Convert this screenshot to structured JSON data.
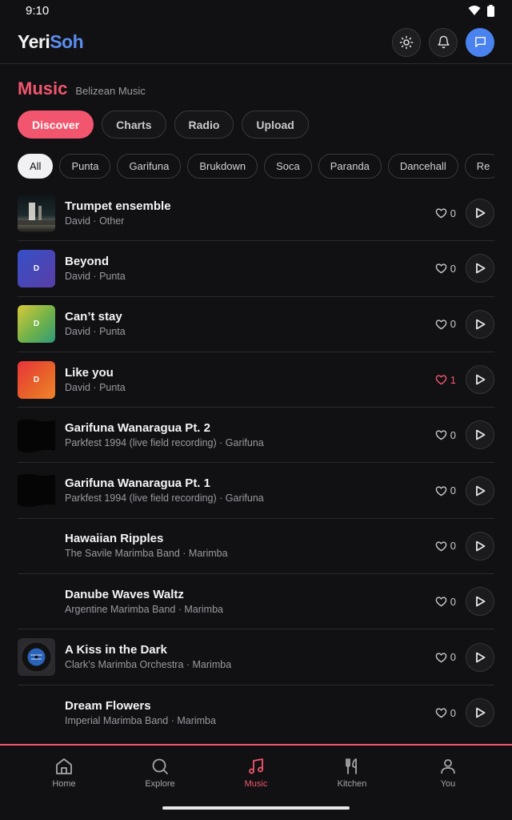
{
  "status": {
    "time": "9:10"
  },
  "header": {
    "logo_part1": "Yeri",
    "logo_part2": "Soh"
  },
  "page": {
    "title": "Music",
    "subtitle": "Belizean Music"
  },
  "tabs": [
    {
      "label": "Discover"
    },
    {
      "label": "Charts"
    },
    {
      "label": "Radio"
    },
    {
      "label": "Upload"
    }
  ],
  "chips": [
    {
      "label": "All"
    },
    {
      "label": "Punta"
    },
    {
      "label": "Garifuna"
    },
    {
      "label": "Brukdown"
    },
    {
      "label": "Soca"
    },
    {
      "label": "Paranda"
    },
    {
      "label": "Dancehall"
    },
    {
      "label": "Re"
    }
  ],
  "tracks": [
    {
      "title": "Trumpet ensemble",
      "meta": "David · Other",
      "likes": "0",
      "thumb": ""
    },
    {
      "title": "Beyond",
      "meta": "David · Punta",
      "likes": "0",
      "thumb": "D"
    },
    {
      "title": "Can’t stay",
      "meta": "David · Punta",
      "likes": "0",
      "thumb": "D"
    },
    {
      "title": "Like you",
      "meta": "David · Punta",
      "likes": "1",
      "thumb": "D"
    },
    {
      "title": "Garifuna Wanaragua Pt. 2",
      "meta": "Parkfest 1994 (live field recording) · Garifuna",
      "likes": "0",
      "thumb": ""
    },
    {
      "title": "Garifuna Wanaragua Pt. 1",
      "meta": "Parkfest 1994 (live field recording) · Garifuna",
      "likes": "0",
      "thumb": ""
    },
    {
      "title": "Hawaiian Ripples",
      "meta": "The Savile Marimba Band · Marimba",
      "likes": "0",
      "thumb": ""
    },
    {
      "title": "Danube Waves Waltz",
      "meta": "Argentine Marimba Band · Marimba",
      "likes": "0",
      "thumb": ""
    },
    {
      "title": "A Kiss in the Dark",
      "meta": "Clark’s Marimba Orchestra · Marimba",
      "likes": "0",
      "thumb": ""
    },
    {
      "title": "Dream Flowers",
      "meta": "Imperial Marimba Band · Marimba",
      "likes": "0",
      "thumb": ""
    }
  ],
  "nav": [
    {
      "label": "Home",
      "icon": "home-icon"
    },
    {
      "label": "Explore",
      "icon": "search-icon"
    },
    {
      "label": "Music",
      "icon": "music-note-icon"
    },
    {
      "label": "Kitchen",
      "icon": "fork-knife-icon"
    },
    {
      "label": "You",
      "icon": "user-icon"
    }
  ],
  "colors": {
    "accent": "#f2566e",
    "brand_blue": "#5b8def",
    "background": "#111113"
  }
}
